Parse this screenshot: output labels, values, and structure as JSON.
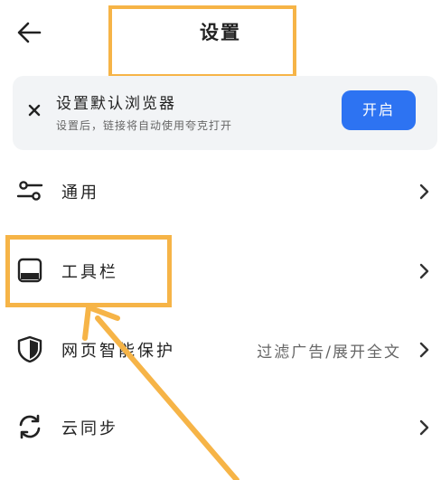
{
  "header": {
    "title": "设置",
    "back_icon": "arrow-left-icon"
  },
  "banner": {
    "title": "设置默认浏览器",
    "subtitle": "设置后，链接将自动使用夸克打开",
    "button_label": "开启",
    "close_icon": "close-icon",
    "accent": "#2D73F2"
  },
  "settings": {
    "items": [
      {
        "label": "通用",
        "value": "",
        "icon": "sliders-icon"
      },
      {
        "label": "工具栏",
        "value": "",
        "icon": "toolbar-icon"
      },
      {
        "label": "网页智能保护",
        "value": "过滤广告/展开全文",
        "icon": "shield-icon"
      },
      {
        "label": "云同步",
        "value": "",
        "icon": "sync-icon"
      }
    ]
  },
  "annotation_color": "#F6B447"
}
